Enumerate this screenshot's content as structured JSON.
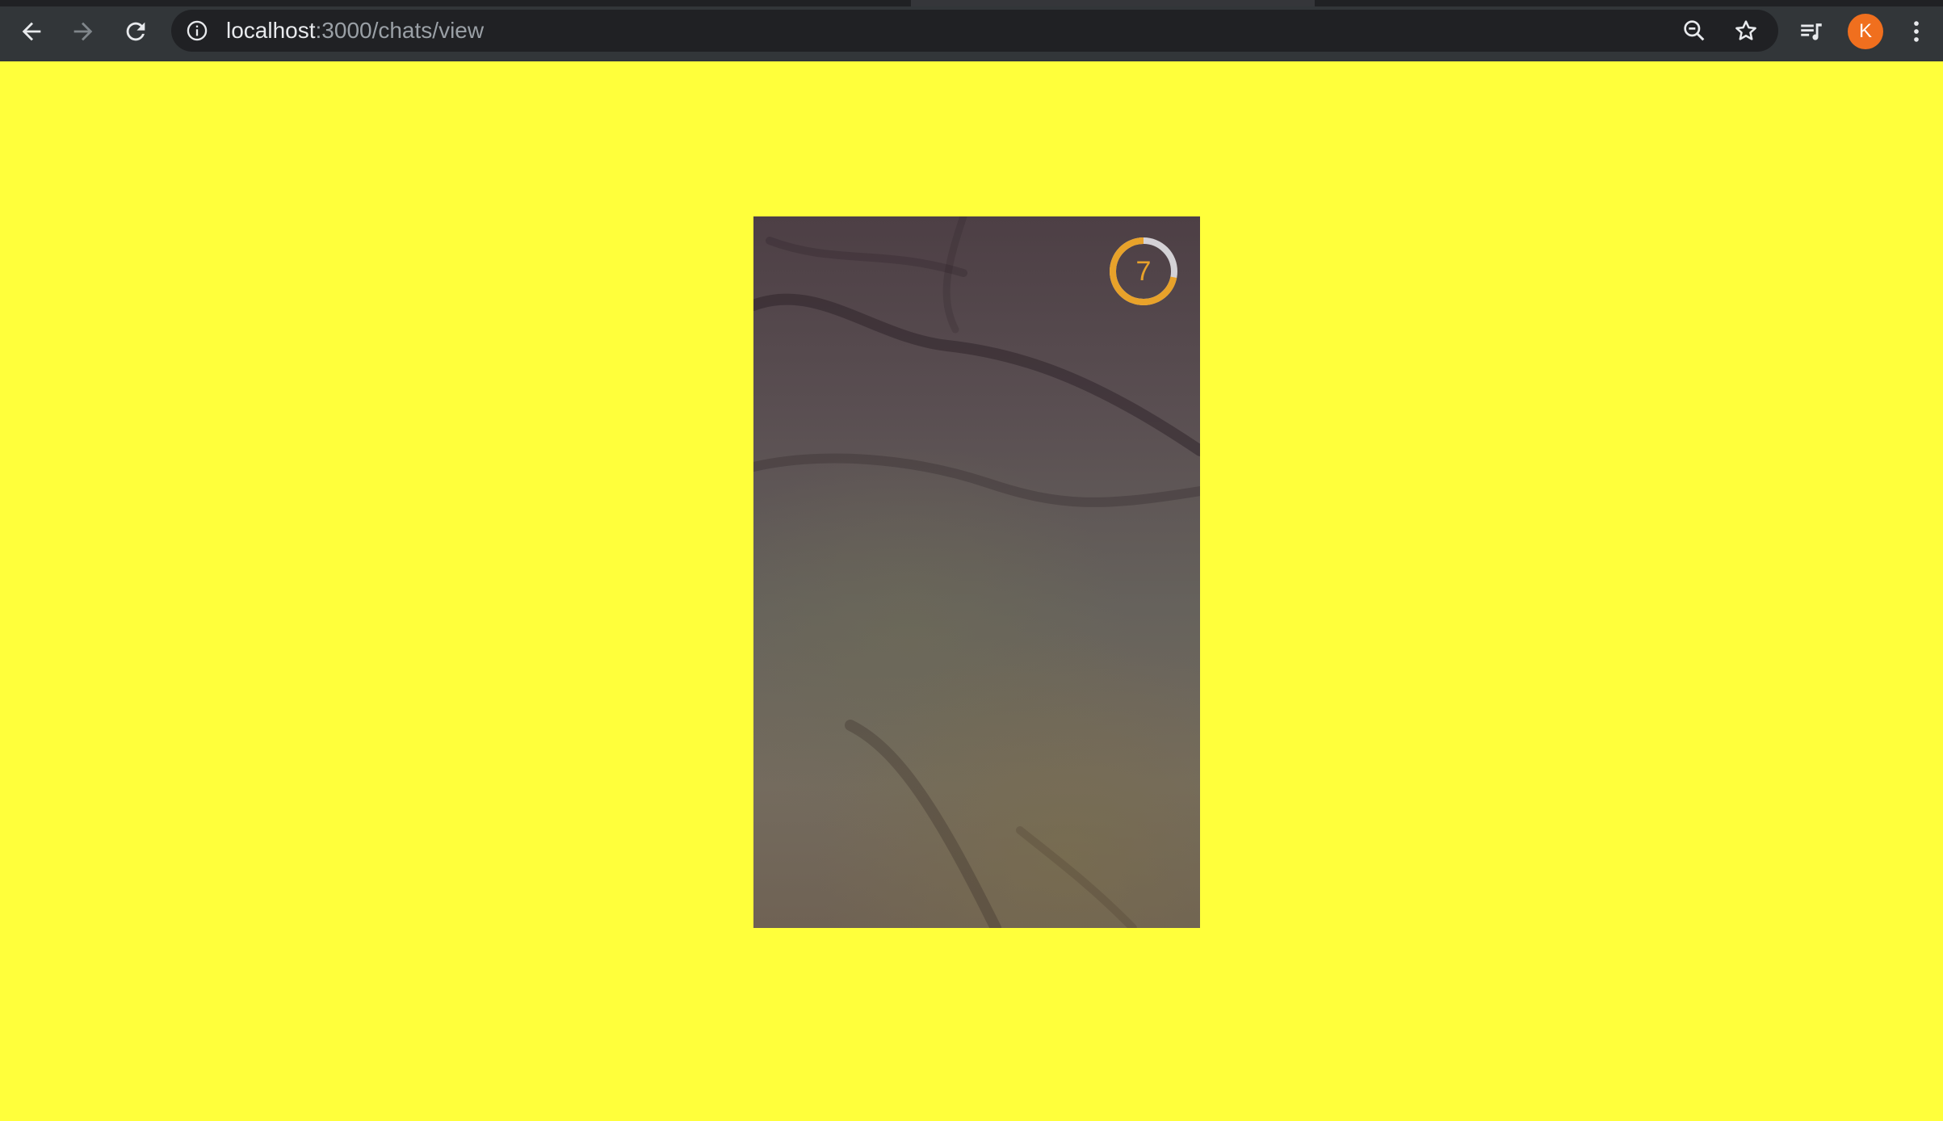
{
  "browser": {
    "url_host": "localhost",
    "url_path": ":3000/chats/view",
    "profile_initial": "K",
    "icons": {
      "back": "arrow-left-icon",
      "forward": "arrow-right-icon",
      "reload": "reload-icon",
      "site_info": "info-icon",
      "zoom": "zoom-out-icon",
      "bookmark": "star-icon",
      "media": "media-queue-icon",
      "menu": "more-vertical-icon"
    }
  },
  "viewer": {
    "timer_seconds": "7",
    "timer_progress": 0.72
  },
  "colors": {
    "page_background": "#ffff3b",
    "timer_accent": "#e8a22a",
    "avatar": "#f06f1e"
  }
}
